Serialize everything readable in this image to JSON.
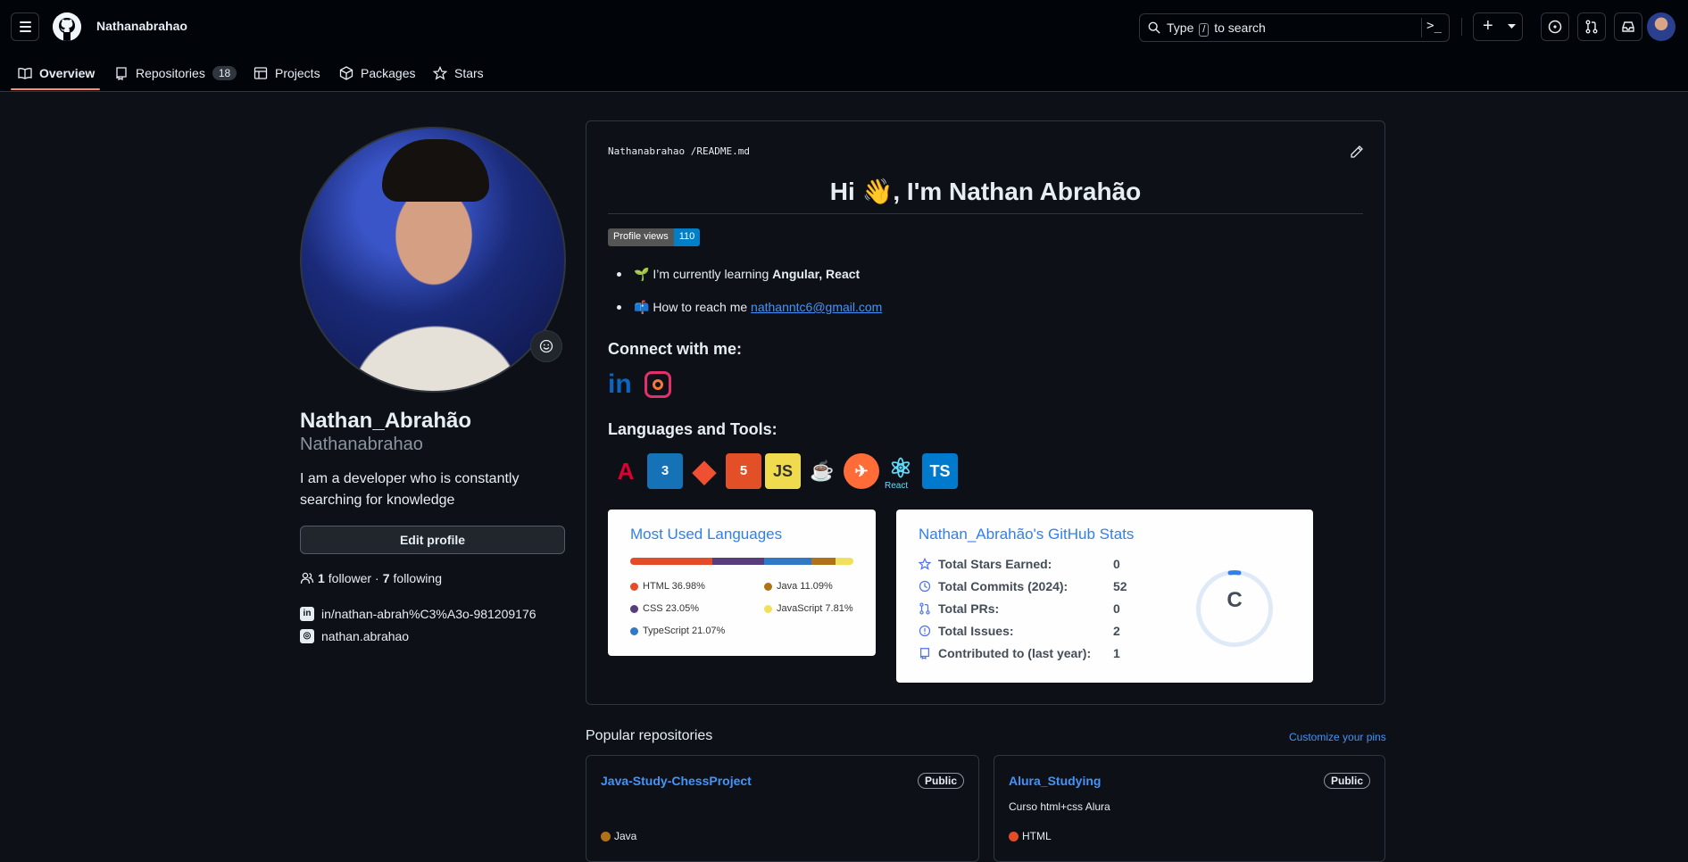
{
  "header": {
    "username": "Nathanabrahao",
    "search_prefix": "Type",
    "search_key": "/",
    "search_suffix": "to search",
    "command_symbol": ">_",
    "plus_symbol": "+"
  },
  "tabs": [
    {
      "label": "Overview",
      "icon": "book-icon"
    },
    {
      "label": "Repositories",
      "icon": "repo-icon",
      "count": "18"
    },
    {
      "label": "Projects",
      "icon": "table-icon"
    },
    {
      "label": "Packages",
      "icon": "package-icon"
    },
    {
      "label": "Stars",
      "icon": "star-icon"
    }
  ],
  "profile": {
    "display_name": "Nathan_Abrahão",
    "login": "Nathanabrahao",
    "bio": "I am a developer who is constantly searching for knowledge",
    "edit_button": "Edit profile",
    "followers_count": "1",
    "followers_label": "follower",
    "separator": "·",
    "following_count": "7",
    "following_label": "following",
    "social": [
      {
        "icon": "linkedin-icon",
        "text": "in/nathan-abrah%C3%A3o-981209176"
      },
      {
        "icon": "instagram-icon",
        "text": "nathan.abrahao"
      }
    ]
  },
  "readme": {
    "path_user": "Nathanabrahao",
    "path_sep": "/",
    "path_file": "README.md",
    "title": "Hi 👋, I'm Nathan Abrahão",
    "badge_label": "Profile views",
    "badge_value": "110",
    "learning_prefix": "🌱 I’m currently learning",
    "learning_value": "Angular, React",
    "reach_prefix": "📫 How to reach me",
    "reach_email": "nathanntc6@gmail.com",
    "connect_heading": "Connect with me:",
    "tools_heading": "Languages and Tools:",
    "tools": [
      {
        "icon": "angular-icon",
        "text": "A",
        "color": "#dd0031"
      },
      {
        "icon": "css3-icon",
        "text": "3",
        "color": "#1572b6"
      },
      {
        "icon": "git-icon",
        "text": "◆",
        "color": "#f05032"
      },
      {
        "icon": "html5-icon",
        "text": "5",
        "color": "#e34f26"
      },
      {
        "icon": "javascript-icon",
        "text": "JS",
        "color": "#f0db4f"
      },
      {
        "icon": "java-icon",
        "text": "☕",
        "color": "#0d1117"
      },
      {
        "icon": "postman-icon",
        "text": "✈",
        "color": "#ff6c37"
      },
      {
        "icon": "react-icon",
        "text": "⚛",
        "color": "#0d1117"
      },
      {
        "icon": "typescript-icon",
        "text": "TS",
        "color": "#007acc"
      }
    ],
    "react_caption": "React"
  },
  "languages_card": {
    "title": "Most Used Languages",
    "langs": [
      {
        "name": "HTML",
        "percent": 36.98,
        "label": "HTML 36.98%",
        "color": "#e34c26"
      },
      {
        "name": "CSS",
        "percent": 23.05,
        "label": "CSS 23.05%",
        "color": "#563d7c"
      },
      {
        "name": "TypeScript",
        "percent": 21.07,
        "label": "TypeScript 21.07%",
        "color": "#3178c6"
      },
      {
        "name": "Java",
        "percent": 11.09,
        "label": "Java 11.09%",
        "color": "#b07219"
      },
      {
        "name": "JavaScript",
        "percent": 7.81,
        "label": "JavaScript 7.81%",
        "color": "#f1e05a"
      }
    ]
  },
  "stats_card": {
    "title": "Nathan_Abrahão's GitHub Stats",
    "rows": [
      {
        "icon": "star-icon",
        "label": "Total Stars Earned:",
        "value": "0"
      },
      {
        "icon": "history-icon",
        "label": "Total Commits (2024):",
        "value": "52"
      },
      {
        "icon": "pull-request-icon",
        "label": "Total PRs:",
        "value": "0"
      },
      {
        "icon": "issue-icon",
        "label": "Total Issues:",
        "value": "2"
      },
      {
        "icon": "repo-icon",
        "label": "Contributed to (last year):",
        "value": "1"
      }
    ],
    "grade": "C",
    "grade_color": "#2f80ed"
  },
  "popular": {
    "title": "Popular repositories",
    "customize": "Customize your pins",
    "repos": [
      {
        "name": "Java-Study-ChessProject",
        "visibility": "Public",
        "description": "",
        "language": "Java",
        "lang_color": "#b07219"
      },
      {
        "name": "Alura_Studying",
        "visibility": "Public",
        "description": "Curso html+css Alura",
        "language": "HTML",
        "lang_color": "#e34c26"
      }
    ]
  }
}
